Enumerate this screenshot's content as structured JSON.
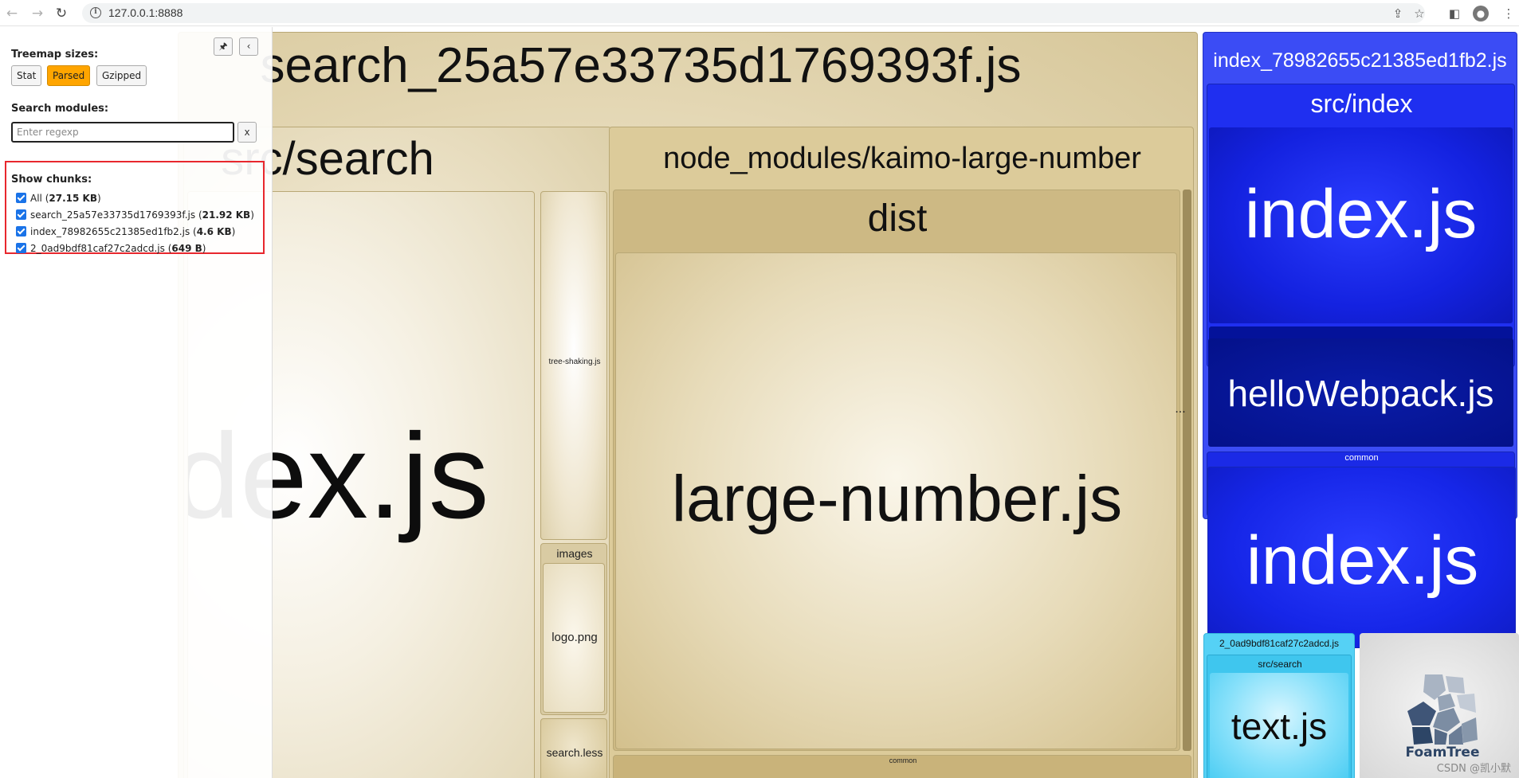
{
  "browser": {
    "url": "127.0.0.1:8888"
  },
  "sidebar": {
    "treemap_sizes_label": "Treemap sizes:",
    "size_buttons": [
      "Stat",
      "Parsed",
      "Gzipped"
    ],
    "active_size": "Parsed",
    "search_label": "Search modules:",
    "search_placeholder": "Enter regexp",
    "clear_label": "x",
    "show_chunks_label": "Show chunks:",
    "chunks": [
      {
        "name": "All",
        "size": "27.15 KB",
        "checked": true
      },
      {
        "name": "search_25a57e33735d1769393f.js",
        "size": "21.92 KB",
        "checked": true
      },
      {
        "name": "index_78982655c21385ed1fb2.js",
        "size": "4.6 KB",
        "checked": true
      },
      {
        "name": "2_0ad9bdf81caf27c2adcd.js",
        "size": "649 B",
        "checked": true
      }
    ]
  },
  "treemap": {
    "search_chunk": "search_25a57e33735d1769393f.js",
    "src_search": "src/search",
    "index_js": "index.js",
    "tree_shaking": "tree-shaking.js",
    "images": "images",
    "logo": "logo.png",
    "search_less": "search.less",
    "node_modules": "node_modules/kaimo-large-number",
    "dist": "dist",
    "large_number": "large-number.js",
    "common_bottom": "common",
    "ellipsis": "...",
    "index_chunk": "index_78982655c21385ed1fb2.js",
    "src_index": "src/index",
    "index_js_blue": "index.js",
    "hello_webpack": "helloWebpack.js",
    "common_blue": "common",
    "index_js_common": "index.js",
    "chunk2": "2_0ad9bdf81caf27c2adcd.js",
    "src_search_cyan": "src/search",
    "text_js": "text.js",
    "foamtree": "FoamTree"
  },
  "watermark": "CSDN @凯小默",
  "colors": {
    "active_button": "#ffa500",
    "highlight_border": "#e8272d",
    "checkbox": "#1a73e8"
  }
}
